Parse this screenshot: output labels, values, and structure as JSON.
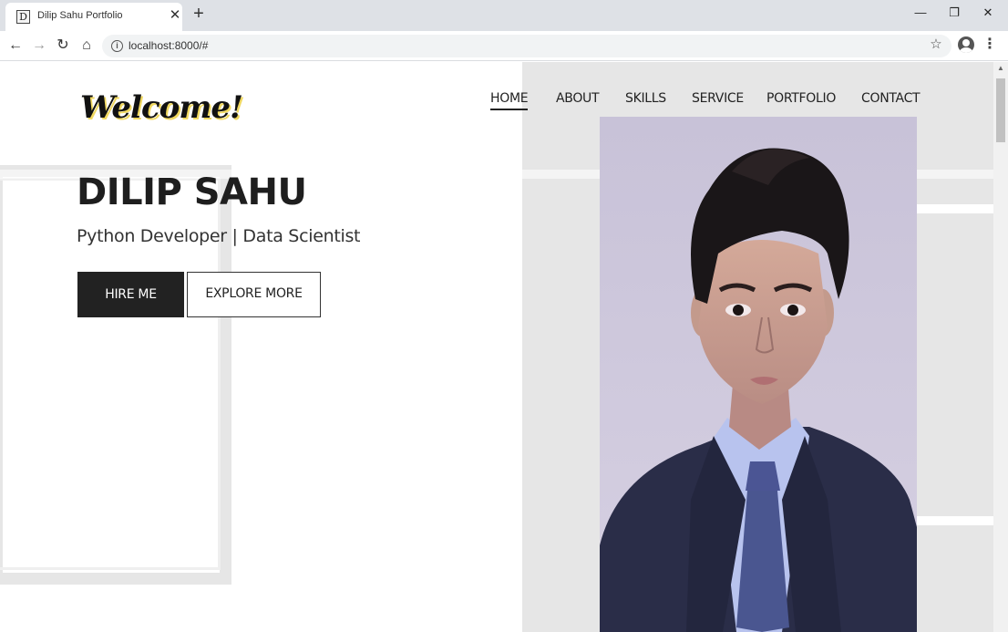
{
  "browser": {
    "tab_title": "Dilip Sahu Portfolio",
    "tab_favicon_letter": "D",
    "url": "localhost:8000/#",
    "icons": [
      "back-icon",
      "forward-icon",
      "reload-icon",
      "home-icon",
      "info-icon",
      "star-icon",
      "profile-icon",
      "menu-icon",
      "minimize-icon",
      "restore-icon",
      "close-icon"
    ]
  },
  "page": {
    "logo_text": "Welcome!",
    "nav": [
      "HOME",
      "ABOUT",
      "SKILLS",
      "SERVICE",
      "PORTFOLIO",
      "CONTACT"
    ],
    "active_nav": "HOME",
    "name": "DILIP SAHU",
    "subtitle": "Python Developer | Data Scientist",
    "hire_button": "HIRE ME",
    "explore_button": "EXPLORE MORE"
  },
  "colors": {
    "accent_dark": "#222222",
    "panel_gray": "#e6e6e6",
    "logo_shadow": "#f0d860",
    "tabbar": "#dee1e6"
  }
}
